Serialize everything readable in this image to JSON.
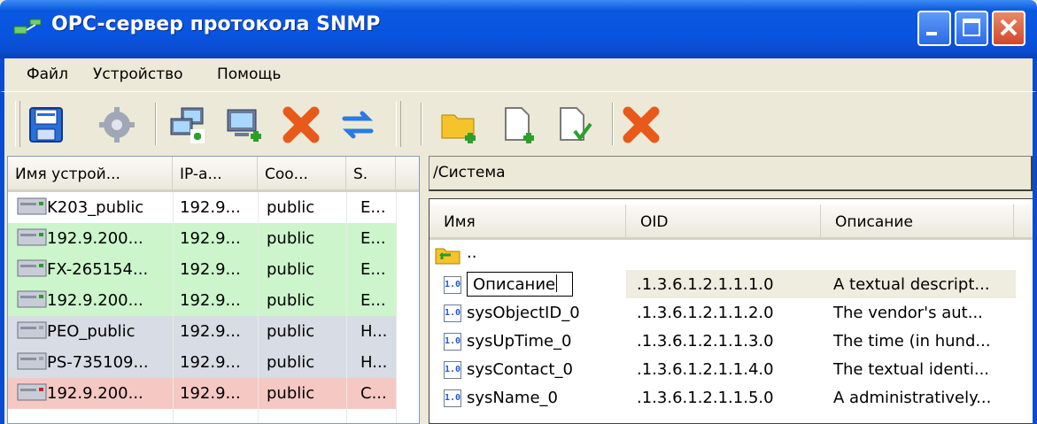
{
  "window": {
    "title": "OPC-сервер протокола SNMP",
    "icon": "network-app-icon",
    "colors": {
      "titlebar": "#0a58e0",
      "close": "#d2482a"
    }
  },
  "menu": [
    "Файл",
    "Устройство",
    "Помощь"
  ],
  "toolbar": {
    "left_buttons": [
      "save-icon",
      "gear-icon",
      "add-device-network-icon",
      "add-device-icon",
      "delete-icon",
      "refresh-icon"
    ],
    "right_buttons": [
      "add-folder-icon",
      "add-object-icon",
      "check-object-icon",
      "delete-icon"
    ]
  },
  "devices": {
    "columns": [
      "Имя устрой...",
      "IP-а...",
      "Соо...",
      "S."
    ],
    "rows": [
      {
        "name": "K203_public",
        "ip": "192.9...",
        "community": "public",
        "status": "E...",
        "state": "none",
        "led": "#2a9a2a"
      },
      {
        "name": "192.9.200...",
        "ip": "192.9...",
        "community": "public",
        "status": "E...",
        "state": "ok",
        "led": "#2a9a2a"
      },
      {
        "name": "FX-265154...",
        "ip": "192.9...",
        "community": "public",
        "status": "E...",
        "state": "ok",
        "led": "#2a9a2a"
      },
      {
        "name": "192.9.200...",
        "ip": "192.9...",
        "community": "public",
        "status": "E...",
        "state": "ok",
        "led": "#2a9a2a"
      },
      {
        "name": "PEO_public",
        "ip": "192.9...",
        "community": "public",
        "status": "H...",
        "state": "inactive",
        "led": "#9aa2b0"
      },
      {
        "name": "PS-735109...",
        "ip": "192.9...",
        "community": "public",
        "status": "H...",
        "state": "inactive",
        "led": "#9aa2b0"
      },
      {
        "name": "192.9.200...",
        "ip": "192.9...",
        "community": "public",
        "status": "C...",
        "state": "error",
        "led": "#d02020"
      }
    ]
  },
  "path": "/Система",
  "objects": {
    "columns": [
      "Имя",
      "OID",
      "Описание"
    ],
    "up_label": "..",
    "rows": [
      {
        "name": "Описание",
        "oid": ".1.3.6.1.2.1.1.1.0",
        "description": "A textual descript...",
        "editing": true
      },
      {
        "name": "sysObjectID_0",
        "oid": ".1.3.6.1.2.1.1.2.0",
        "description": "The vendor's aut..."
      },
      {
        "name": "sysUpTime_0",
        "oid": ".1.3.6.1.2.1.1.3.0",
        "description": "The time (in hund..."
      },
      {
        "name": "sysContact_0",
        "oid": ".1.3.6.1.2.1.1.4.0",
        "description": "The textual identi..."
      },
      {
        "name": "sysName_0",
        "oid": ".1.3.6.1.2.1.1.5.0",
        "description": "A administratively..."
      }
    ],
    "value_icon_text": "1.0"
  }
}
